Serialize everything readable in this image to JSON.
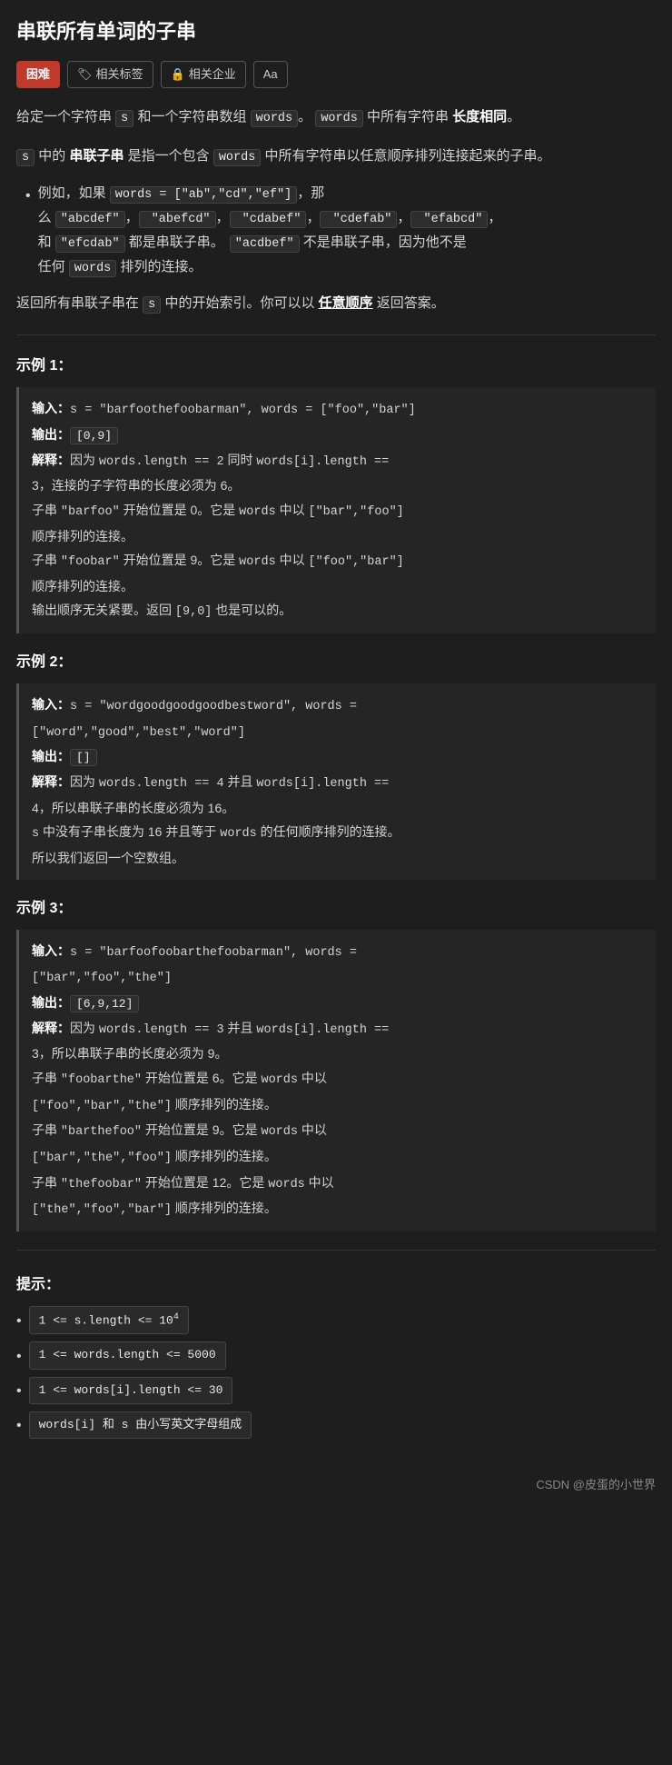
{
  "page": {
    "title": "串联所有单词的子串",
    "tags": [
      {
        "id": "difficulty",
        "label": "困难",
        "type": "difficulty"
      },
      {
        "id": "related-tags",
        "label": "相关标签",
        "icon": "🏷",
        "type": "normal"
      },
      {
        "id": "related-company",
        "label": "相关企业",
        "icon": "🔒",
        "type": "normal"
      },
      {
        "id": "font-size",
        "label": "Aa",
        "type": "normal"
      }
    ],
    "description": {
      "para1": "给定一个字符串 s 和一个字符串数组 words。 words 中所有字符串 长度相同。",
      "para2": "s 中的 串联子串 是指一个包含 words 中所有字符串以任意顺序排列连接起来的子串。",
      "bullet_example_intro": "例如，如果 words = [\"ab\",\"cd\",\"ef\"]，那么",
      "bullet_example_valid": "\"abcdef\"，\"abefcd\"，\"cdabef\"，\"cdefab\"，\"efabcd\"，和 \"efcdab\" 都是串联子串。",
      "bullet_example_invalid": "\"acdbef\" 不是串联子串，因为他不是任何 words 排列的连接。",
      "para3": "返回所有串联子串在 s 中的开始索引。你可以以 任意顺序 返回答案。"
    },
    "examples": [
      {
        "id": 1,
        "title": "示例 1：",
        "input_label": "输入：",
        "input_value": "s = \"barfoothefoobarman\", words = [\"foo\",\"bar\"]",
        "output_label": "输出：",
        "output_value": "[0,9]",
        "explain_label": "解释：",
        "explain_lines": [
          "因为 words.length == 2 同时 words[i].length == 3，连接的子字符串的长度必须为 6。",
          "子串 \"barfoo\" 开始位置是 0。它是 words 中以 [\"bar\",\"foo\"] 顺序排列的连接。",
          "子串 \"foobar\" 开始位置是 9。它是 words 中以 [\"foo\",\"bar\"] 顺序排列的连接。",
          "输出顺序无关紧要。返回 [9,0] 也是可以的。"
        ]
      },
      {
        "id": 2,
        "title": "示例 2：",
        "input_label": "输入：",
        "input_value": "s = \"wordgoodgoodgoodbestword\", words = [\"word\",\"good\",\"best\",\"word\"]",
        "output_label": "输出：",
        "output_value": "[]",
        "explain_label": "解释：",
        "explain_lines": [
          "因为 words.length == 4 并且 words[i].length == 4，所以串联子串的长度必须为 16。",
          "s 中没有子串长度为 16 并且等于 words 的任何顺序排列的连接。",
          "所以我们返回一个空数组。"
        ]
      },
      {
        "id": 3,
        "title": "示例 3：",
        "input_label": "输入：",
        "input_value": "s = \"barfoofoobarthefoobarman\", words = [\"bar\",\"foo\",\"the\"]",
        "output_label": "输出：",
        "output_value": "[6,9,12]",
        "explain_label": "解释：",
        "explain_lines": [
          "因为 words.length == 3 并且 words[i].length == 3，所以串联子串的长度必须为 9。",
          "子串 \"foobarthe\" 开始位置是 6。它是 words 中以 [\"foo\",\"bar\",\"the\"] 顺序排列的连接。",
          "子串 \"barthefoo\" 开始位置是 9。它是 words 中以 [\"bar\",\"the\",\"foo\"] 顺序排列的连接。",
          "子串 \"thefoobar\" 开始位置是 12。它是 words 中以 [\"the\",\"foo\",\"bar\"] 顺序排列的连接。"
        ]
      }
    ],
    "hints": {
      "title": "提示：",
      "items": [
        "1 <= s.length <= 10⁴",
        "1 <= words.length <= 5000",
        "1 <= words[i].length <= 30",
        "words[i] 和 s 由小写英文字母组成"
      ]
    },
    "footer": {
      "text": "CSDN @皮蛋的小世界"
    }
  }
}
